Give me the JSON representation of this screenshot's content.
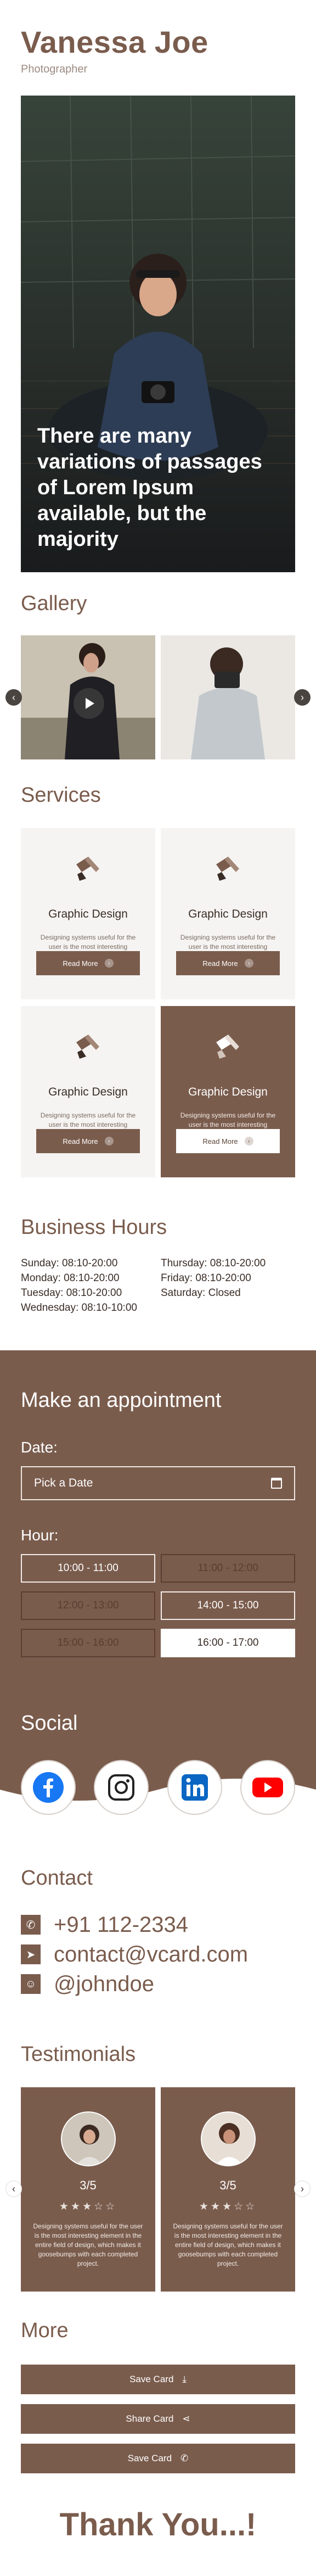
{
  "profile": {
    "name": "Vanessa Joe",
    "role": "Photographer"
  },
  "hero": {
    "caption": "There are many variations of passages of Lorem Ipsum available, but the majority"
  },
  "gallery": {
    "title": "Gallery"
  },
  "services": {
    "title": "Services",
    "items": [
      {
        "title": "Graphic Design",
        "desc": "Designing systems useful for the user is the most interesting element in the entire field of design.",
        "button": "Read More"
      },
      {
        "title": "Graphic Design",
        "desc": "Designing systems useful for the user is the most interesting element in the entire field of design.",
        "button": "Read More"
      },
      {
        "title": "Graphic Design",
        "desc": "Designing systems useful for the user is the most interesting element in the entire field of design.",
        "button": "Read More"
      },
      {
        "title": "Graphic Design",
        "desc": "Designing systems useful for the user is the most interesting element in the entire field of design.",
        "button": "Read More"
      }
    ]
  },
  "hours": {
    "title": "Business Hours",
    "left": [
      "Sunday: 08:10-20:00",
      "Monday: 08:10-20:00",
      "Tuesday: 08:10-20:00",
      "Wednesday: 08:10-10:00"
    ],
    "right": [
      "Thursday: 08:10-20:00",
      "Friday: 08:10-20:00",
      "Saturday: Closed"
    ]
  },
  "appointment": {
    "title": "Make an appointment",
    "date_label": "Date:",
    "date_placeholder": "Pick a Date",
    "hour_label": "Hour:",
    "slots": [
      {
        "label": "10:00 - 11:00",
        "state": "available"
      },
      {
        "label": "11:00 - 12:00",
        "state": "disabled"
      },
      {
        "label": "12:00 - 13:00",
        "state": "disabled"
      },
      {
        "label": "14:00 - 15:00",
        "state": "available"
      },
      {
        "label": "15:00 - 16:00",
        "state": "disabled"
      },
      {
        "label": "16:00 - 17:00",
        "state": "selected"
      }
    ]
  },
  "social": {
    "title": "Social",
    "icons": [
      "facebook-icon",
      "instagram-icon",
      "linkedin-icon",
      "youtube-icon"
    ]
  },
  "contact": {
    "title": "Contact",
    "phone": "+91 112-2334",
    "email": "contact@vcard.com",
    "handle": "@johndoe"
  },
  "testimonials": {
    "title": "Testimonials",
    "items": [
      {
        "rating": "3/5",
        "stars": 3,
        "desc": "Designing systems useful for the user is the most interesting element in the entire field of design, which makes it goosebumps with each completed project."
      },
      {
        "rating": "3/5",
        "stars": 3,
        "desc": "Designing systems useful for the user is the most interesting element in the entire field of design, which makes it goosebumps with each completed project."
      }
    ]
  },
  "more": {
    "title": "More",
    "buttons": [
      "Save Card",
      "Share Card",
      "Save Card"
    ]
  },
  "footer": {
    "thanks": "Thank You...!"
  },
  "colors": {
    "accent": "#7a5c4d",
    "text": "#3a2d26",
    "card_bg": "#f6f4f2"
  }
}
